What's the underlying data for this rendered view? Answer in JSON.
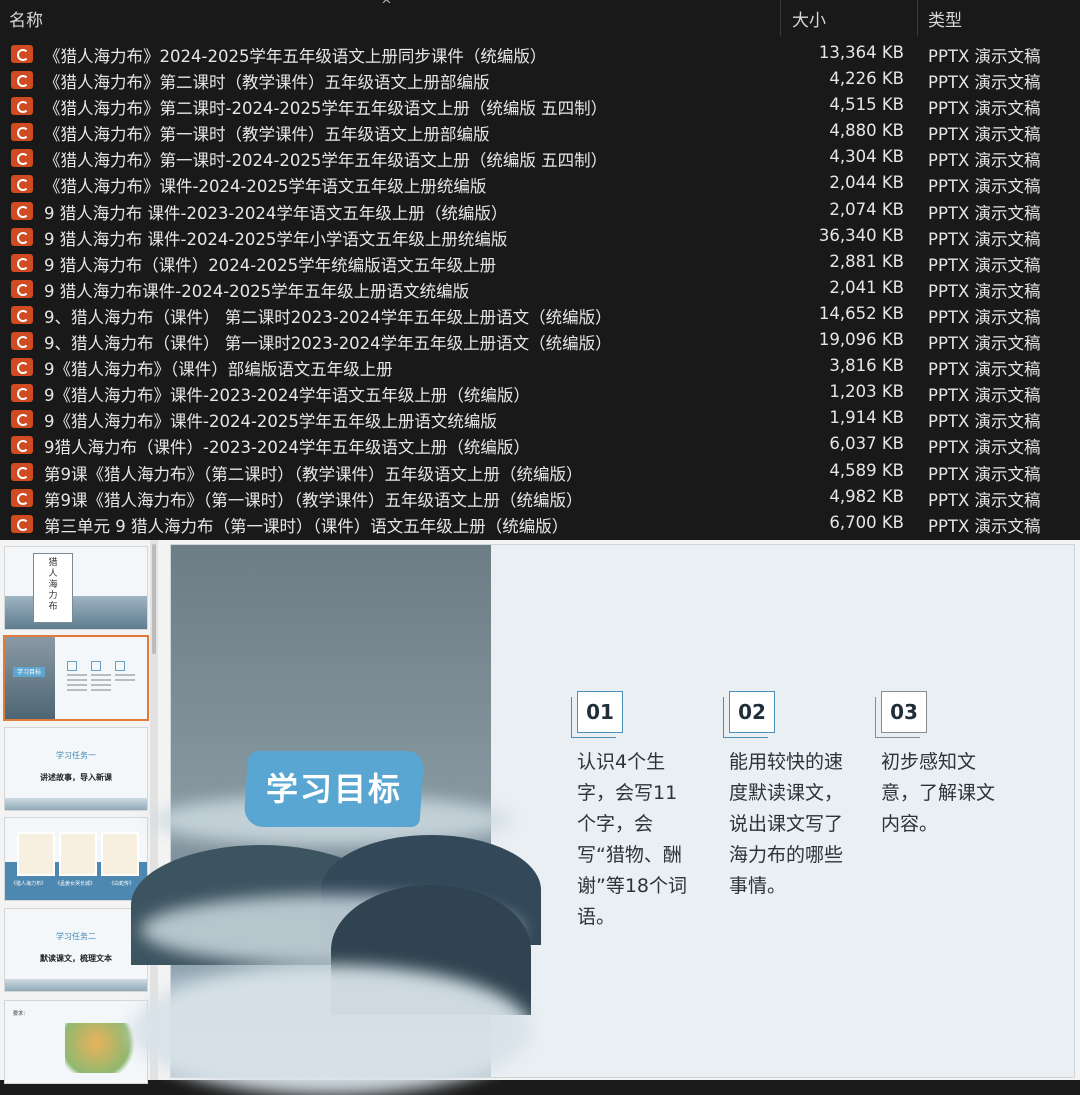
{
  "explorer": {
    "columns": {
      "name": "名称",
      "size": "大小",
      "type": "类型"
    },
    "sort_indicator": "^",
    "files": [
      {
        "name": "《猎人海力布》2024-2025学年五年级语文上册同步课件（统编版）",
        "size": "13,364 KB",
        "type": "PPTX 演示文稿"
      },
      {
        "name": "《猎人海力布》第二课时（教学课件）五年级语文上册部编版",
        "size": "4,226 KB",
        "type": "PPTX 演示文稿"
      },
      {
        "name": "《猎人海力布》第二课时-2024-2025学年五年级语文上册（统编版 五四制）",
        "size": "4,515 KB",
        "type": "PPTX 演示文稿"
      },
      {
        "name": "《猎人海力布》第一课时（教学课件）五年级语文上册部编版",
        "size": "4,880 KB",
        "type": "PPTX 演示文稿"
      },
      {
        "name": "《猎人海力布》第一课时-2024-2025学年五年级语文上册（统编版 五四制）",
        "size": "4,304 KB",
        "type": "PPTX 演示文稿"
      },
      {
        "name": "《猎人海力布》课件-2024-2025学年语文五年级上册统编版",
        "size": "2,044 KB",
        "type": "PPTX 演示文稿"
      },
      {
        "name": "9 猎人海力布 课件-2023-2024学年语文五年级上册（统编版）",
        "size": "2,074 KB",
        "type": "PPTX 演示文稿"
      },
      {
        "name": "9 猎人海力布 课件-2024-2025学年小学语文五年级上册统编版",
        "size": "36,340 KB",
        "type": "PPTX 演示文稿"
      },
      {
        "name": "9 猎人海力布（课件）2024-2025学年统编版语文五年级上册",
        "size": "2,881 KB",
        "type": "PPTX 演示文稿"
      },
      {
        "name": "9 猎人海力布课件-2024-2025学年五年级上册语文统编版",
        "size": "2,041 KB",
        "type": "PPTX 演示文稿"
      },
      {
        "name": "9、猎人海力布（课件） 第二课时2023-2024学年五年级上册语文（统编版）",
        "size": "14,652 KB",
        "type": "PPTX 演示文稿"
      },
      {
        "name": "9、猎人海力布（课件） 第一课时2023-2024学年五年级上册语文（统编版）",
        "size": "19,096 KB",
        "type": "PPTX 演示文稿"
      },
      {
        "name": "9《猎人海力布》（课件）部编版语文五年级上册",
        "size": "3,816 KB",
        "type": "PPTX 演示文稿"
      },
      {
        "name": "9《猎人海力布》课件-2023-2024学年语文五年级上册（统编版）",
        "size": "1,203 KB",
        "type": "PPTX 演示文稿"
      },
      {
        "name": "9《猎人海力布》课件-2024-2025学年五年级上册语文统编版",
        "size": "1,914 KB",
        "type": "PPTX 演示文稿"
      },
      {
        "name": "9猎人海力布（课件）-2023-2024学年五年级语文上册（统编版）",
        "size": "6,037 KB",
        "type": "PPTX 演示文稿"
      },
      {
        "name": "第9课《猎人海力布》（第二课时）（教学课件）五年级语文上册（统编版）",
        "size": "4,589 KB",
        "type": "PPTX 演示文稿"
      },
      {
        "name": "第9课《猎人海力布》（第一课时）（教学课件）五年级语文上册（统编版）",
        "size": "4,982 KB",
        "type": "PPTX 演示文稿"
      },
      {
        "name": "第三单元 9 猎人海力布（第一课时）（课件）语文五年级上册（统编版）",
        "size": "6,700 KB",
        "type": "PPTX 演示文稿"
      }
    ],
    "file_icon": "pptx-file-icon",
    "file_icon_color": "#d04a22"
  },
  "thumbnails": {
    "t1": {
      "title_chars": "猎\n人\n海\n力\n布"
    },
    "t2": {
      "tag": "学习目标"
    },
    "t3": {
      "task": "学习任务一",
      "sub": "讲述故事，导入新课"
    },
    "t4": {
      "captions": [
        "《猎人海力布》",
        "《孟姜女哭长城》",
        "《白蛇传》"
      ]
    },
    "t5": {
      "task": "学习任务二",
      "sub": "默读课文，梳理文本"
    },
    "t6": {
      "heading": "要求："
    },
    "selected_index": 2,
    "selection_color": "#e07a3a"
  },
  "slide": {
    "title": "学习目标",
    "accent_color": "#5aa6d2",
    "goals": [
      {
        "num": "01",
        "text": "认识4个生字，会写11个字，会写“猎物、酬谢”等18个词语。"
      },
      {
        "num": "02",
        "text": "能用较快的速度默读课文，说出课文写了海力布的哪些事情。"
      },
      {
        "num": "03",
        "text": "初步感知文意，了解课文内容。"
      }
    ]
  }
}
